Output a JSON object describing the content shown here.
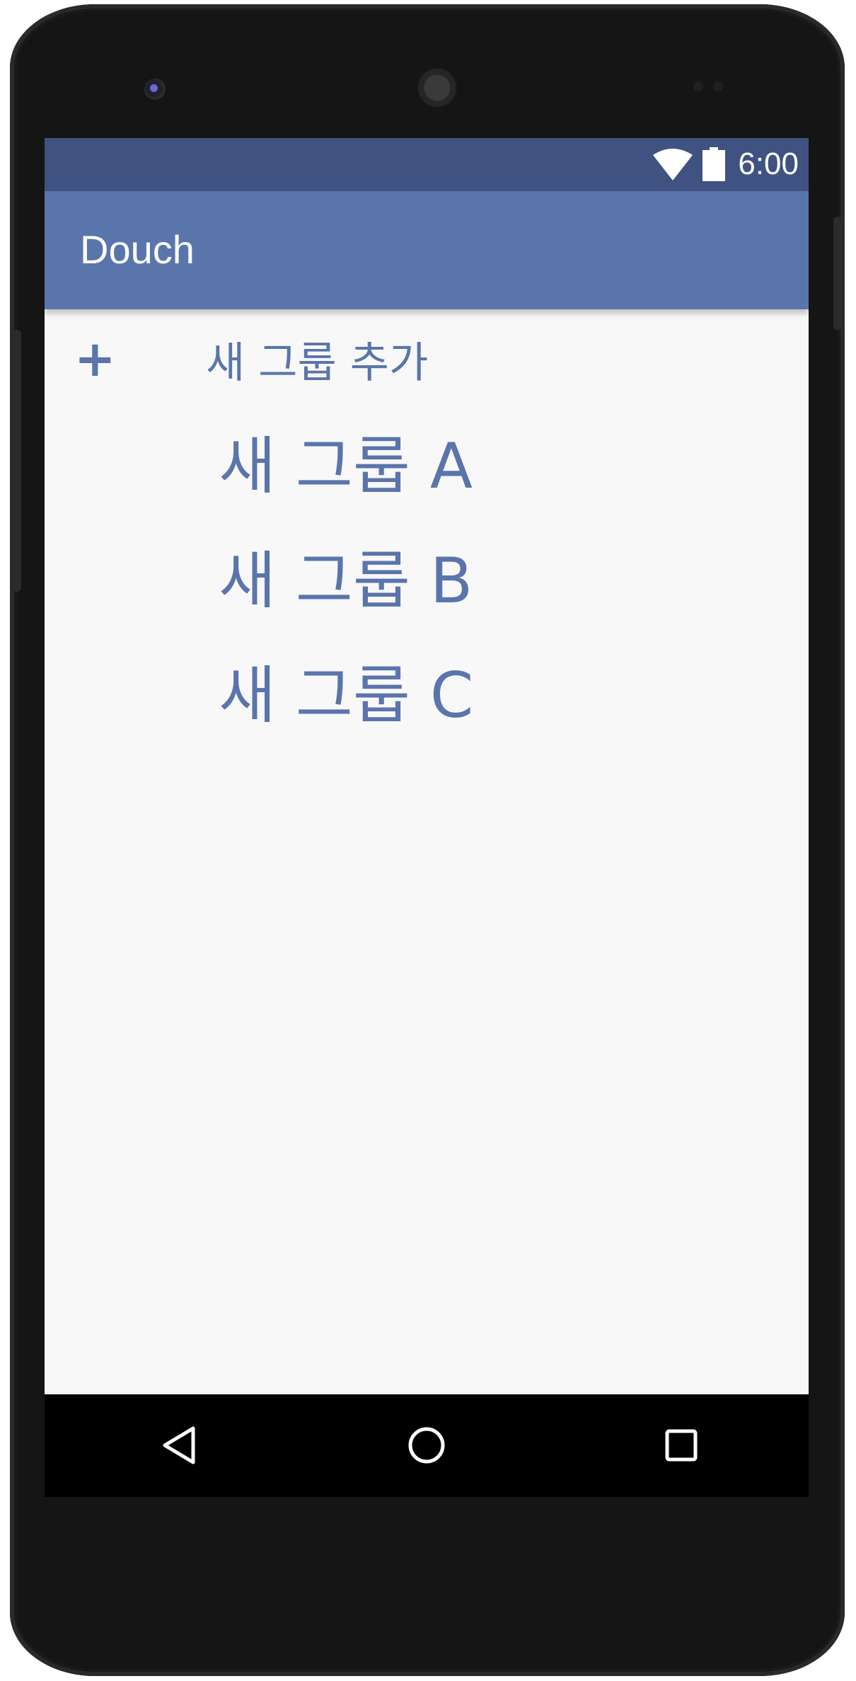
{
  "status_bar": {
    "time": "6:00",
    "icons": [
      "wifi-icon",
      "battery-icon"
    ]
  },
  "app_bar": {
    "title": "Douch"
  },
  "add_group": {
    "icon": "plus-icon",
    "label": "새 그룹 추가"
  },
  "groups": [
    {
      "label": "새 그룹 A"
    },
    {
      "label": "새 그룹 B"
    },
    {
      "label": "새 그룹 C"
    }
  ],
  "nav_bar": {
    "icons": [
      "back-icon",
      "home-icon",
      "recent-apps-icon"
    ]
  },
  "colors": {
    "status_bar": "#405282",
    "app_bar": "#5a75ab",
    "accent_text": "#5a75ab",
    "background": "#f8f8f8"
  }
}
